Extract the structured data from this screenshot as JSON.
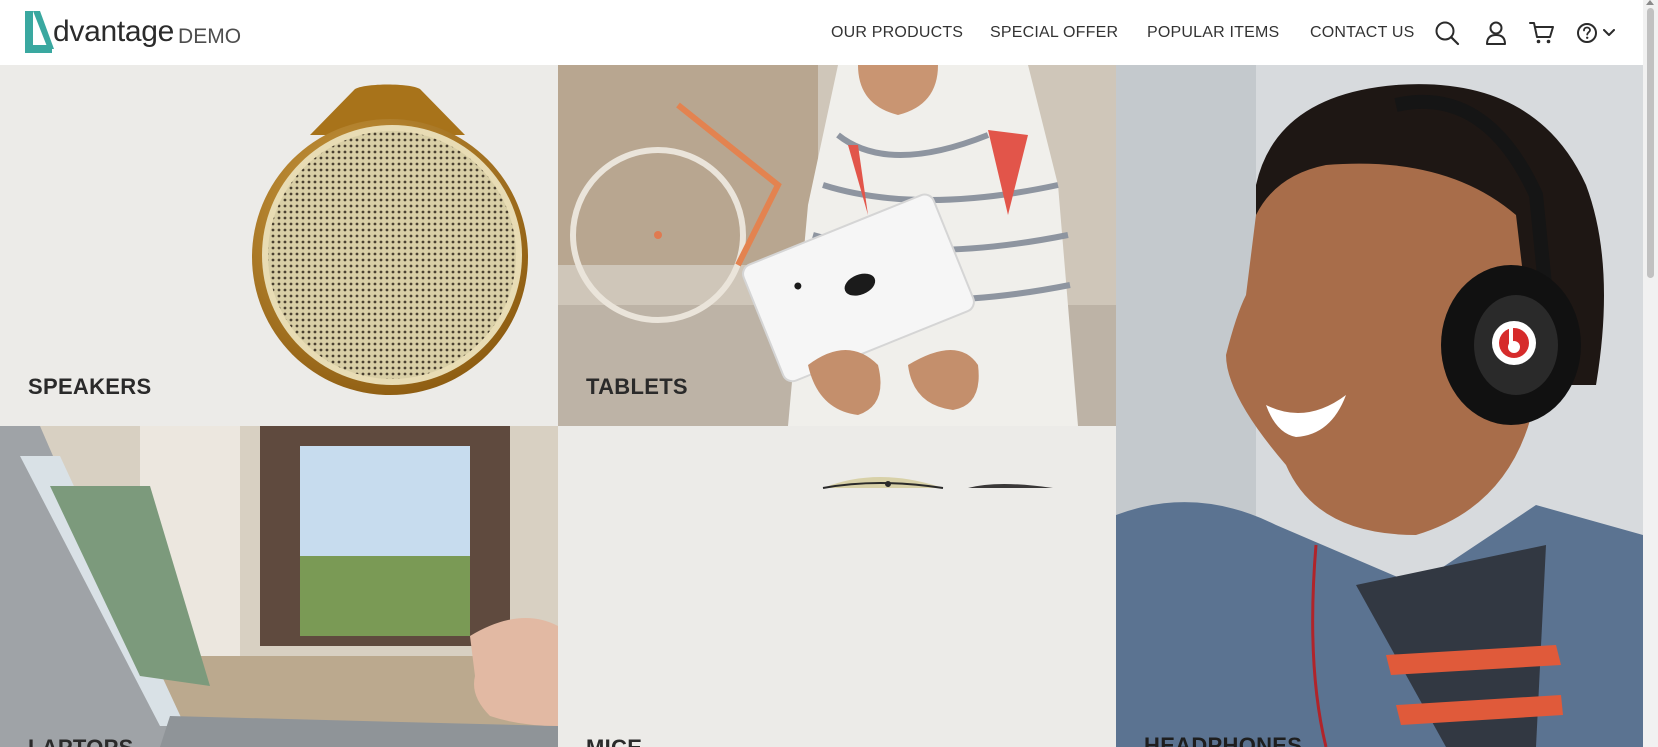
{
  "brand": {
    "name": "dvantage",
    "suffix": "DEMO",
    "accent": "#3aa8a0"
  },
  "nav": {
    "items": [
      {
        "label": "OUR PRODUCTS"
      },
      {
        "label": "SPECIAL OFFER"
      },
      {
        "label": "POPULAR ITEMS"
      },
      {
        "label": "CONTACT US"
      }
    ],
    "icons": [
      "search-icon",
      "user-icon",
      "cart-icon",
      "help-icon",
      "chevron-down-icon"
    ]
  },
  "categories": {
    "speakers": {
      "label": "SPEAKERS"
    },
    "tablets": {
      "label": "TABLETS"
    },
    "headphones": {
      "label": "HEADPHONES"
    },
    "laptops": {
      "label": "LAPTOPS"
    },
    "mice": {
      "label": "MICE"
    }
  },
  "colors": {
    "speaker_gold": "#b07a1a",
    "tile_bg": "#ecebe8"
  }
}
